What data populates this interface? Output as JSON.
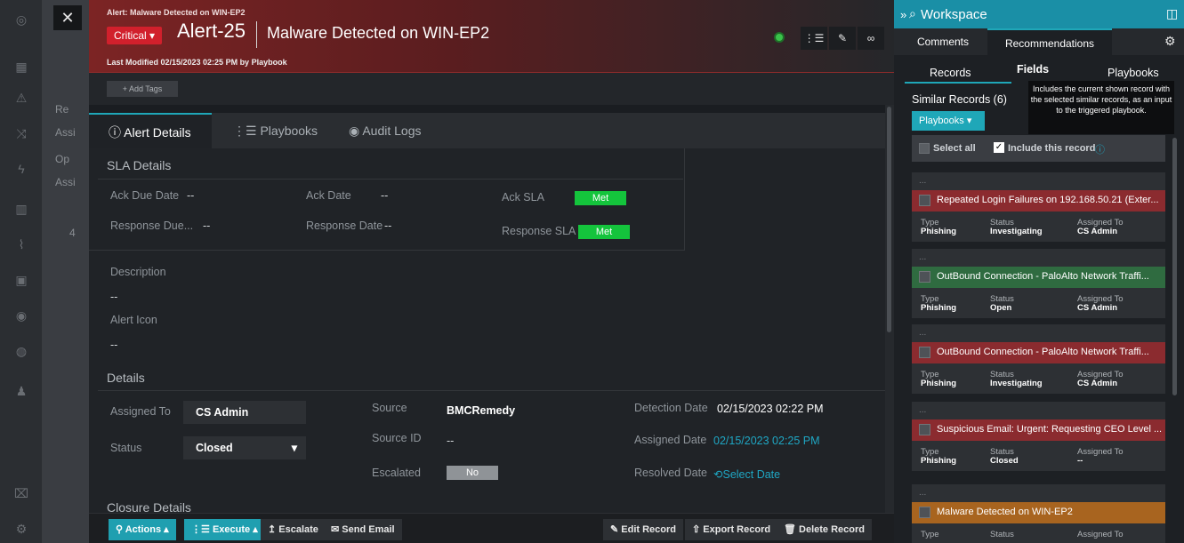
{
  "header": {
    "context": "Alert: Malware Detected on WIN-EP2",
    "severity": "Critical",
    "alert_id": "Alert-25",
    "title": "Malware Detected on WIN-EP2",
    "last_modified": "Last Modified 02/15/2023 02:25 PM by Playbook"
  },
  "tags": {
    "add_label": "+ Add Tags"
  },
  "tabs": [
    {
      "label": "Alert Details"
    },
    {
      "label": "Playbooks"
    },
    {
      "label": "Audit Logs"
    }
  ],
  "sla": {
    "heading": "SLA Details",
    "ack_due_label": "Ack Due Date",
    "ack_due_value": "--",
    "ack_date_label": "Ack Date",
    "ack_date_value": "--",
    "ack_sla_label": "Ack SLA",
    "ack_sla_value": "Met",
    "resp_due_label": "Response Due...",
    "resp_due_value": "--",
    "resp_date_label": "Response Date",
    "resp_date_value": "--",
    "resp_sla_label": "Response SLA",
    "resp_sla_value": "Met"
  },
  "description": {
    "label": "Description",
    "value": "--"
  },
  "alert_icon": {
    "label": "Alert Icon",
    "value": "--"
  },
  "details": {
    "heading": "Details",
    "assigned_to_label": "Assigned To",
    "assigned_to_value": "CS Admin",
    "status_label": "Status",
    "status_value": "Closed",
    "source_label": "Source",
    "source_value": "BMCRemedy",
    "source_id_label": "Source ID",
    "source_id_value": "--",
    "escalated_label": "Escalated",
    "escalated_value": "No",
    "detection_date_label": "Detection Date",
    "detection_date_value": "02/15/2023 02:22 PM",
    "assigned_date_label": "Assigned Date",
    "assigned_date_value": "02/15/2023 02:25 PM",
    "resolved_date_label": "Resolved Date",
    "resolved_date_value": "Select Date"
  },
  "closure": {
    "heading": "Closure Details"
  },
  "footer": {
    "actions": "Actions",
    "execute": "Execute",
    "escalate": "Escalate",
    "send_email": "Send Email",
    "edit_record": "Edit Record",
    "export_record": "Export Record",
    "delete_record": "Delete Record"
  },
  "background": {
    "items": [
      "Re",
      "Assi",
      "Op",
      "Assi",
      "4"
    ]
  },
  "workspace": {
    "title": "Workspace",
    "tabs": [
      "Comments",
      "Recommendations"
    ],
    "subtabs": [
      "Records",
      "Fields",
      "Playbooks"
    ],
    "similar_label": "Similar Records (6)",
    "playbooks_dropdown": "Playbooks",
    "select_all": "Select all",
    "include_record": "Include this record",
    "tooltip": "Includes the current shown record with the selected similar records, as an input to the triggered playbook.",
    "cards": [
      {
        "title": "Repeated Login Failures on 192.168.50.21 (Exter...",
        "type": "Phishing",
        "status": "Investigating",
        "assigned": "CS Admin",
        "color": "#8b2b2f"
      },
      {
        "title": "OutBound Connection - PaloAlto Network Traffi...",
        "type": "Phishing",
        "status": "Open",
        "assigned": "CS Admin",
        "color": "#2f6b40"
      },
      {
        "title": "OutBound Connection - PaloAlto Network Traffi...",
        "type": "Phishing",
        "status": "Investigating",
        "assigned": "CS Admin",
        "color": "#8b2b2f"
      },
      {
        "title": "Suspicious Email: Urgent: Requesting CEO Level ...",
        "type": "Phishing",
        "status": "Closed",
        "assigned": "--",
        "color": "#8b2b2f"
      },
      {
        "title": "Malware Detected on WIN-EP2",
        "type": "",
        "status": "",
        "assigned": "",
        "color": "#a8641f"
      }
    ],
    "field_labels": {
      "type": "Type",
      "status": "Status",
      "assigned": "Assigned To"
    }
  }
}
